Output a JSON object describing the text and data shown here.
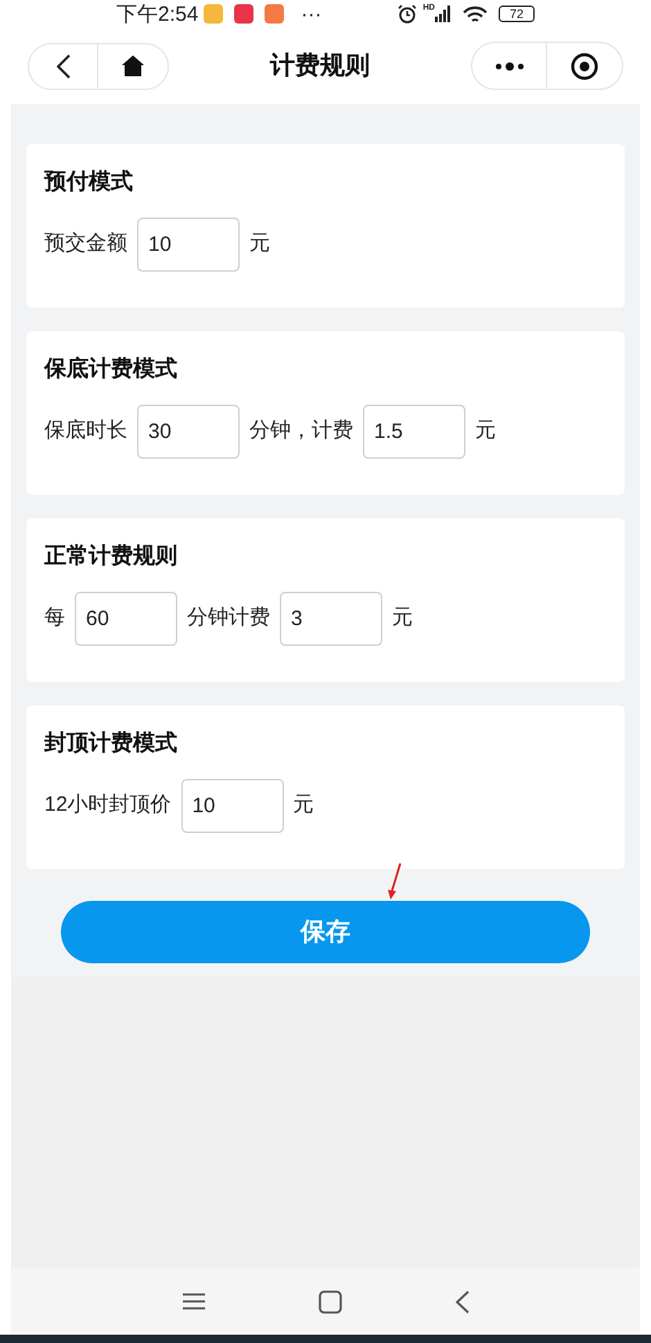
{
  "status_bar": {
    "time": "下午2:54",
    "more": "···",
    "signal_label": "HD",
    "battery": "72"
  },
  "header": {
    "title": "计费规则"
  },
  "sections": [
    {
      "title": "预付模式",
      "items": [
        {
          "kind": "text",
          "text": "预交金额"
        },
        {
          "kind": "input",
          "value": "10"
        },
        {
          "kind": "text",
          "text": "元"
        }
      ]
    },
    {
      "title": "保底计费模式",
      "items": [
        {
          "kind": "text",
          "text": "保底时长"
        },
        {
          "kind": "input",
          "value": "30"
        },
        {
          "kind": "text",
          "text": "分钟，计费"
        },
        {
          "kind": "input",
          "value": "1.5"
        },
        {
          "kind": "text",
          "text": "元"
        }
      ]
    },
    {
      "title": "正常计费规则",
      "items": [
        {
          "kind": "text",
          "text": "每"
        },
        {
          "kind": "input",
          "value": "60"
        },
        {
          "kind": "text",
          "text": "分钟计费"
        },
        {
          "kind": "input",
          "value": "3"
        },
        {
          "kind": "text",
          "text": "元"
        }
      ]
    },
    {
      "title": "封顶计费模式",
      "items": [
        {
          "kind": "text",
          "text": "12小时封顶价"
        },
        {
          "kind": "input",
          "value": "10"
        },
        {
          "kind": "text",
          "text": "元"
        }
      ]
    }
  ],
  "save_button": "保存"
}
